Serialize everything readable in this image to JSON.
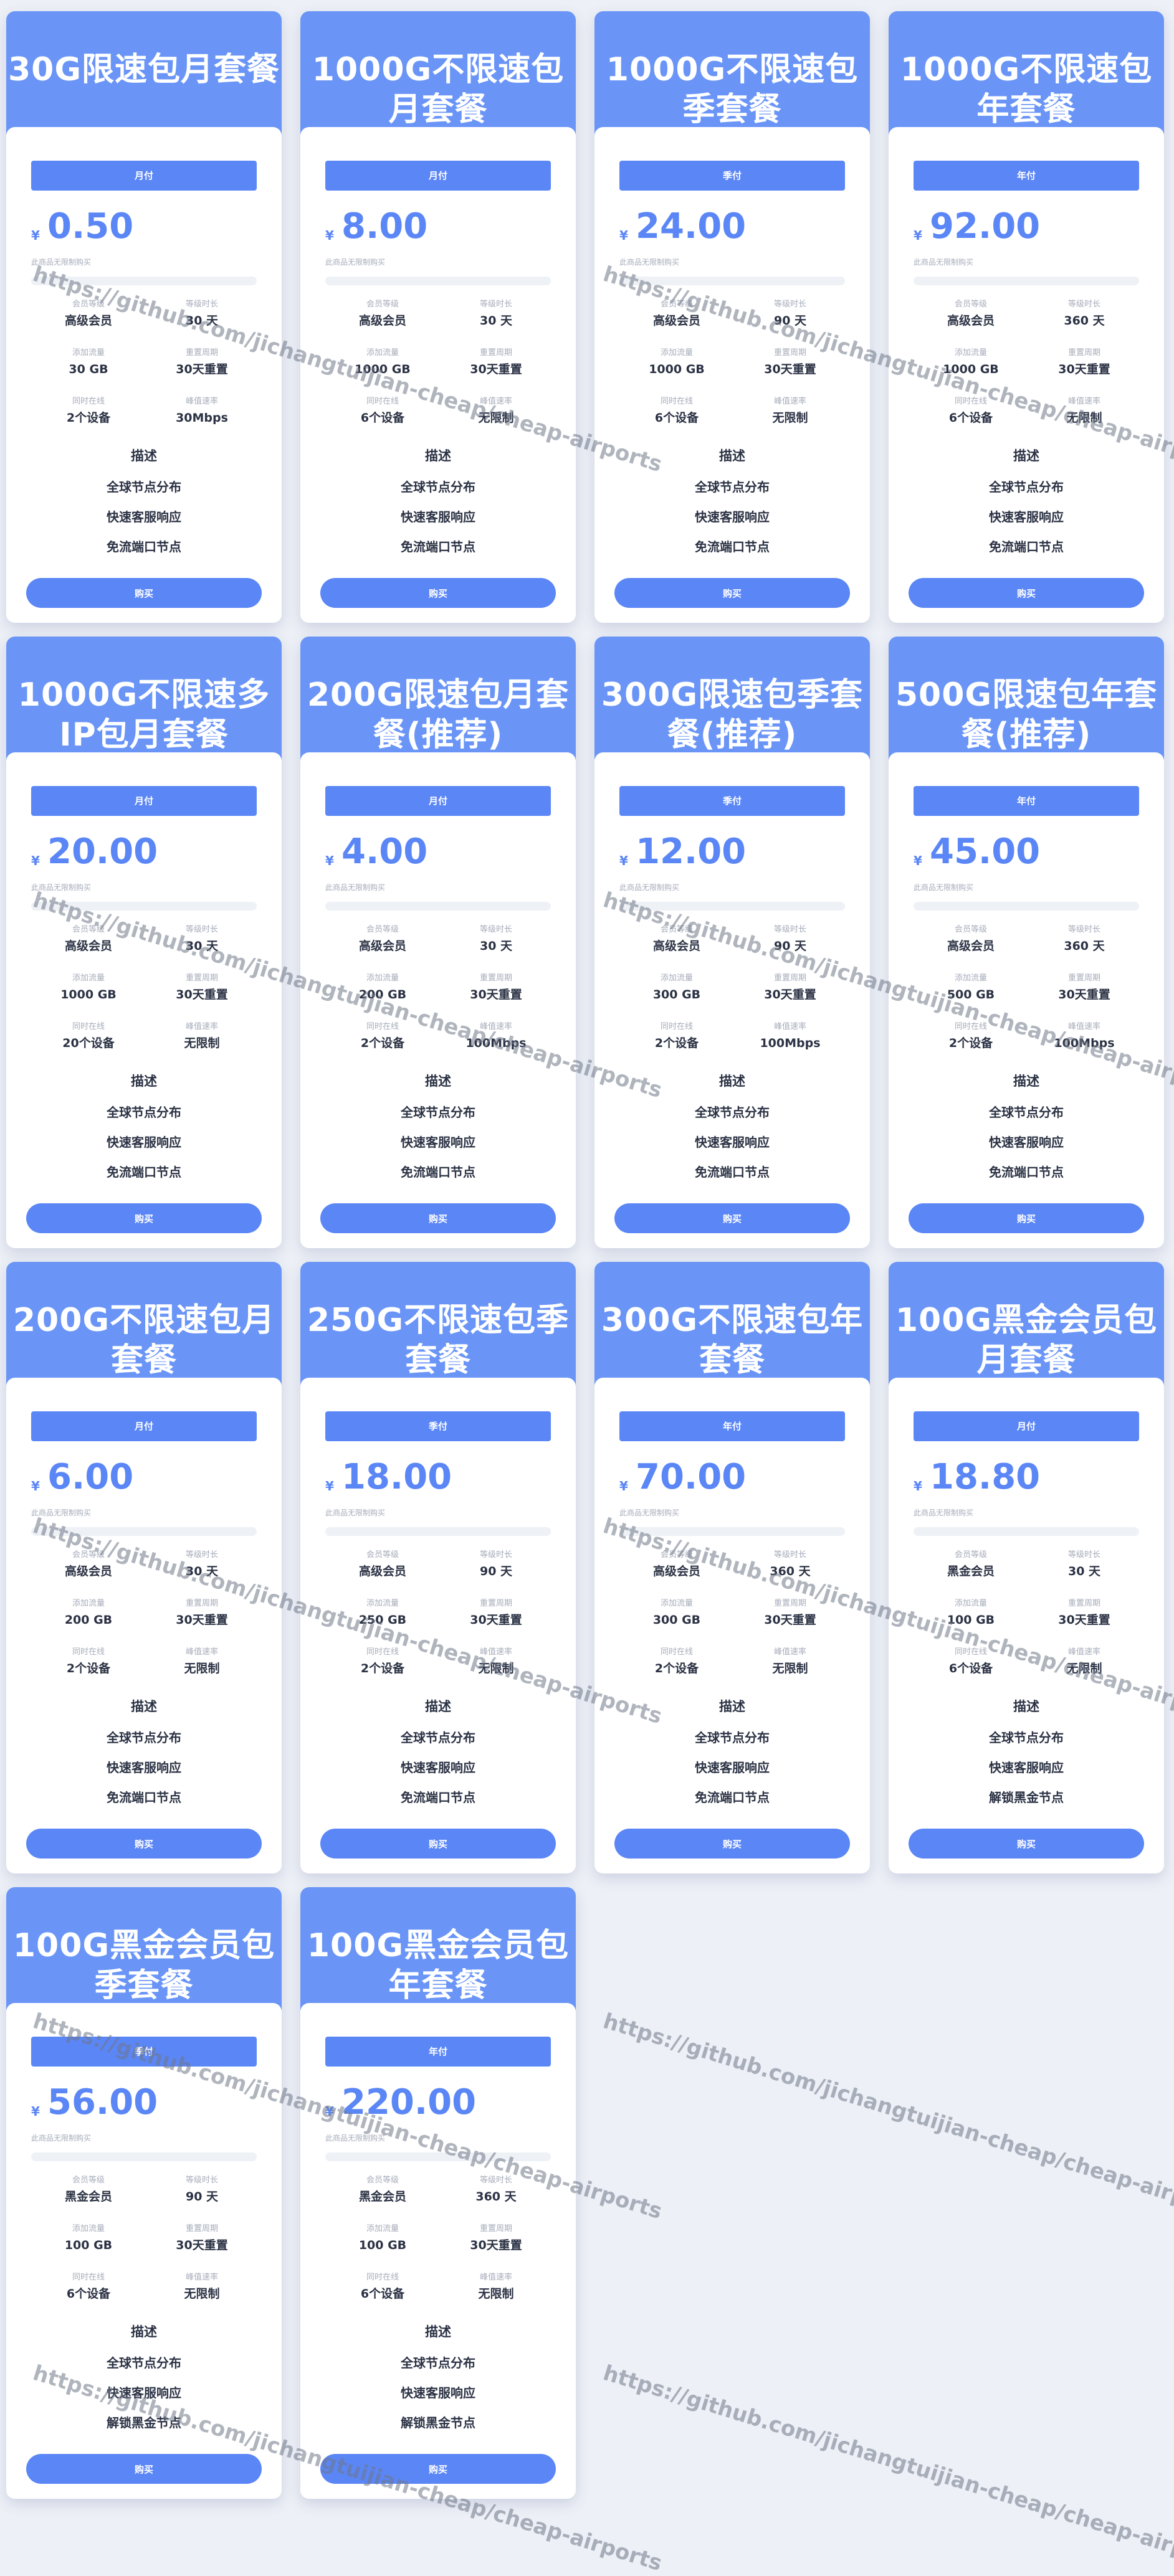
{
  "watermark_text": "https://github.com/jichangtuijian-cheap/cheap-airports",
  "accent_color": "#5b86f6",
  "header_color": "#6a95f7",
  "spec_labels": {
    "level": "会员等级",
    "duration": "等级时长",
    "traffic": "添加流量",
    "reset": "重置周期",
    "devices": "同时在线",
    "speed": "峰值速率"
  },
  "common": {
    "currency": "¥",
    "purchase_note": "此商品无限制购买",
    "description_title": "描述",
    "buy_label": "购买"
  },
  "plans": [
    {
      "title": "30G限速包月套餐",
      "cycle": "月付",
      "price": "0.50",
      "level": "高级会员",
      "duration": "30 天",
      "traffic": "30 GB",
      "reset": "30天重置",
      "devices": "2个设备",
      "speed": "30Mbps",
      "features": [
        "全球节点分布",
        "快速客服响应",
        "免流端口节点"
      ]
    },
    {
      "title": "1000G不限速包月套餐",
      "cycle": "月付",
      "price": "8.00",
      "level": "高级会员",
      "duration": "30 天",
      "traffic": "1000 GB",
      "reset": "30天重置",
      "devices": "6个设备",
      "speed": "无限制",
      "features": [
        "全球节点分布",
        "快速客服响应",
        "免流端口节点"
      ]
    },
    {
      "title": "1000G不限速包季套餐",
      "cycle": "季付",
      "price": "24.00",
      "level": "高级会员",
      "duration": "90 天",
      "traffic": "1000 GB",
      "reset": "30天重置",
      "devices": "6个设备",
      "speed": "无限制",
      "features": [
        "全球节点分布",
        "快速客服响应",
        "免流端口节点"
      ]
    },
    {
      "title": "1000G不限速包年套餐",
      "cycle": "年付",
      "price": "92.00",
      "level": "高级会员",
      "duration": "360 天",
      "traffic": "1000 GB",
      "reset": "30天重置",
      "devices": "6个设备",
      "speed": "无限制",
      "features": [
        "全球节点分布",
        "快速客服响应",
        "免流端口节点"
      ]
    },
    {
      "title": "1000G不限速多IP包月套餐",
      "cycle": "月付",
      "price": "20.00",
      "level": "高级会员",
      "duration": "30 天",
      "traffic": "1000 GB",
      "reset": "30天重置",
      "devices": "20个设备",
      "speed": "无限制",
      "features": [
        "全球节点分布",
        "快速客服响应",
        "免流端口节点"
      ]
    },
    {
      "title": "200G限速包月套餐(推荐)",
      "cycle": "月付",
      "price": "4.00",
      "level": "高级会员",
      "duration": "30 天",
      "traffic": "200 GB",
      "reset": "30天重置",
      "devices": "2个设备",
      "speed": "100Mbps",
      "features": [
        "全球节点分布",
        "快速客服响应",
        "免流端口节点"
      ]
    },
    {
      "title": "300G限速包季套餐(推荐)",
      "cycle": "季付",
      "price": "12.00",
      "level": "高级会员",
      "duration": "90 天",
      "traffic": "300 GB",
      "reset": "30天重置",
      "devices": "2个设备",
      "speed": "100Mbps",
      "features": [
        "全球节点分布",
        "快速客服响应",
        "免流端口节点"
      ]
    },
    {
      "title": "500G限速包年套餐(推荐)",
      "cycle": "年付",
      "price": "45.00",
      "level": "高级会员",
      "duration": "360 天",
      "traffic": "500 GB",
      "reset": "30天重置",
      "devices": "2个设备",
      "speed": "100Mbps",
      "features": [
        "全球节点分布",
        "快速客服响应",
        "免流端口节点"
      ]
    },
    {
      "title": "200G不限速包月套餐",
      "cycle": "月付",
      "price": "6.00",
      "level": "高级会员",
      "duration": "30 天",
      "traffic": "200 GB",
      "reset": "30天重置",
      "devices": "2个设备",
      "speed": "无限制",
      "features": [
        "全球节点分布",
        "快速客服响应",
        "免流端口节点"
      ]
    },
    {
      "title": "250G不限速包季套餐",
      "cycle": "季付",
      "price": "18.00",
      "level": "高级会员",
      "duration": "90 天",
      "traffic": "250 GB",
      "reset": "30天重置",
      "devices": "2个设备",
      "speed": "无限制",
      "features": [
        "全球节点分布",
        "快速客服响应",
        "免流端口节点"
      ]
    },
    {
      "title": "300G不限速包年套餐",
      "cycle": "年付",
      "price": "70.00",
      "level": "高级会员",
      "duration": "360 天",
      "traffic": "300 GB",
      "reset": "30天重置",
      "devices": "2个设备",
      "speed": "无限制",
      "features": [
        "全球节点分布",
        "快速客服响应",
        "免流端口节点"
      ]
    },
    {
      "title": "100G黑金会员包月套餐",
      "cycle": "月付",
      "price": "18.80",
      "level": "黑金会员",
      "duration": "30 天",
      "traffic": "100 GB",
      "reset": "30天重置",
      "devices": "6个设备",
      "speed": "无限制",
      "features": [
        "全球节点分布",
        "快速客服响应",
        "解锁黑金节点"
      ]
    },
    {
      "title": "100G黑金会员包季套餐",
      "cycle": "季付",
      "price": "56.00",
      "level": "黑金会员",
      "duration": "90 天",
      "traffic": "100 GB",
      "reset": "30天重置",
      "devices": "6个设备",
      "speed": "无限制",
      "features": [
        "全球节点分布",
        "快速客服响应",
        "解锁黑金节点"
      ]
    },
    {
      "title": "100G黑金会员包年套餐",
      "cycle": "年付",
      "price": "220.00",
      "level": "黑金会员",
      "duration": "360 天",
      "traffic": "100 GB",
      "reset": "30天重置",
      "devices": "6个设备",
      "speed": "无限制",
      "features": [
        "全球节点分布",
        "快速客服响应",
        "解锁黑金节点"
      ]
    }
  ]
}
